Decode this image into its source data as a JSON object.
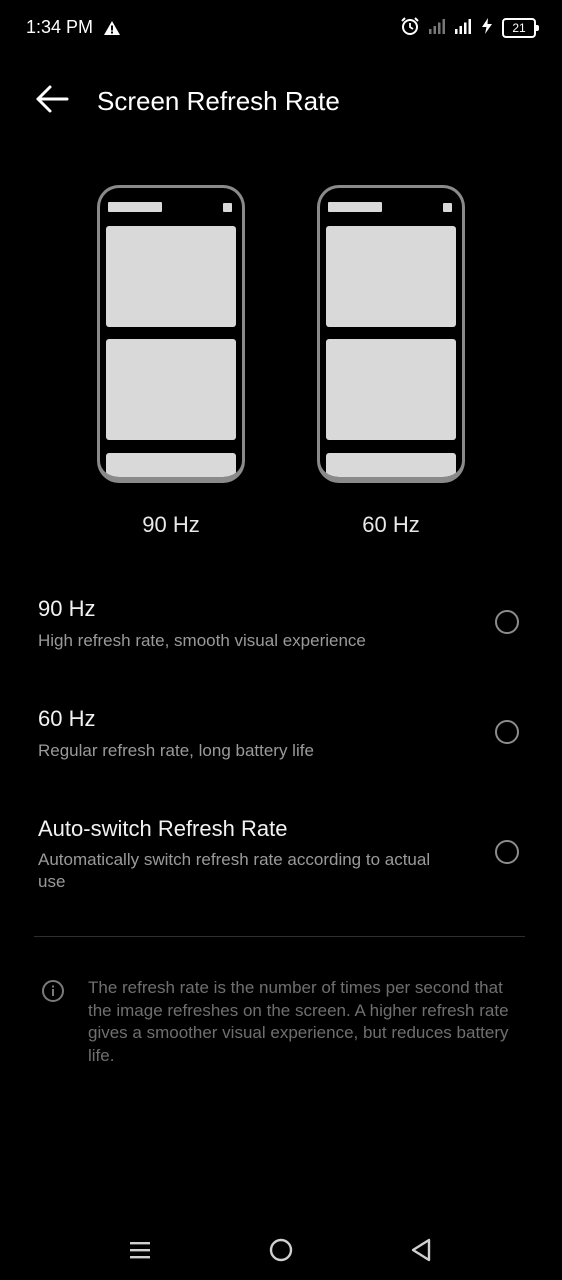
{
  "status_bar": {
    "time": "1:34 PM",
    "battery_level": "21",
    "icons": [
      "warning-icon",
      "alarm-icon",
      "signal-icon",
      "signal-icon",
      "charging-icon",
      "battery-icon"
    ]
  },
  "header": {
    "title": "Screen Refresh Rate",
    "back_icon": "back-arrow-icon"
  },
  "previews": [
    {
      "label": "90 Hz"
    },
    {
      "label": "60 Hz"
    }
  ],
  "options": [
    {
      "title": "90 Hz",
      "description": "High refresh rate, smooth visual experience",
      "selected": false
    },
    {
      "title": "60 Hz",
      "description": "Regular refresh rate, long battery life",
      "selected": false
    },
    {
      "title": "Auto-switch Refresh Rate",
      "description": "Automatically switch refresh rate according to actual use",
      "selected": false
    }
  ],
  "info": {
    "icon": "info-icon",
    "text": "The refresh rate is the number of times per second that the image refreshes on the screen. A higher refresh rate gives a smoother visual experience, but reduces battery life."
  },
  "nav_bar": {
    "icons": [
      "menu-icon",
      "home-icon",
      "back-icon"
    ]
  },
  "colors": {
    "background": "#000000",
    "text_primary": "#f2f2f2",
    "text_secondary": "#9a9a9a",
    "preview_fill": "#d9d9d9",
    "preview_frame": "#8a8a8a"
  }
}
